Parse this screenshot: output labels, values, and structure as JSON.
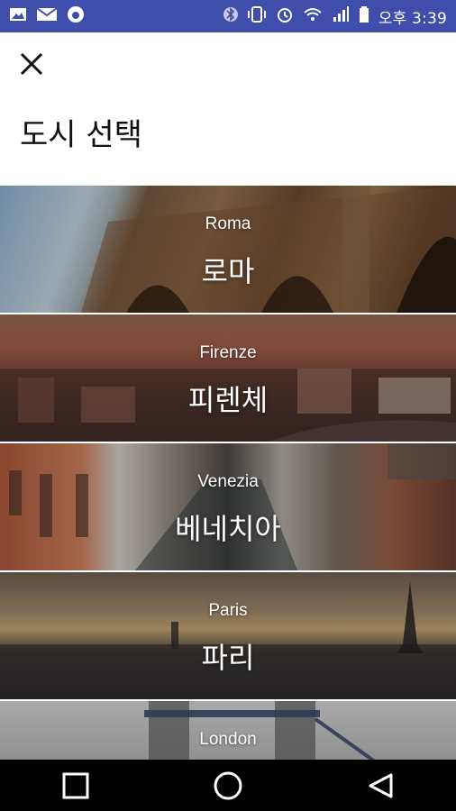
{
  "status_bar": {
    "time": "오후 3:39",
    "icons_left": [
      "gallery-icon",
      "mail-icon",
      "assistant-icon"
    ],
    "icons_right": [
      "bluetooth-icon",
      "vibrate-icon",
      "alarm-icon",
      "wifi-icon",
      "signal-icon",
      "battery-icon"
    ],
    "background": "#3f4eaa"
  },
  "header": {
    "close_icon": "close-icon",
    "title": "도시 선택"
  },
  "cities": [
    {
      "en": "Roma",
      "ko": "로마"
    },
    {
      "en": "Firenze",
      "ko": "피렌체"
    },
    {
      "en": "Venezia",
      "ko": "베네치아"
    },
    {
      "en": "Paris",
      "ko": "파리"
    },
    {
      "en": "London",
      "ko": ""
    }
  ],
  "nav_bar": {
    "icons": [
      "recent-apps-icon",
      "home-icon",
      "back-icon"
    ]
  }
}
